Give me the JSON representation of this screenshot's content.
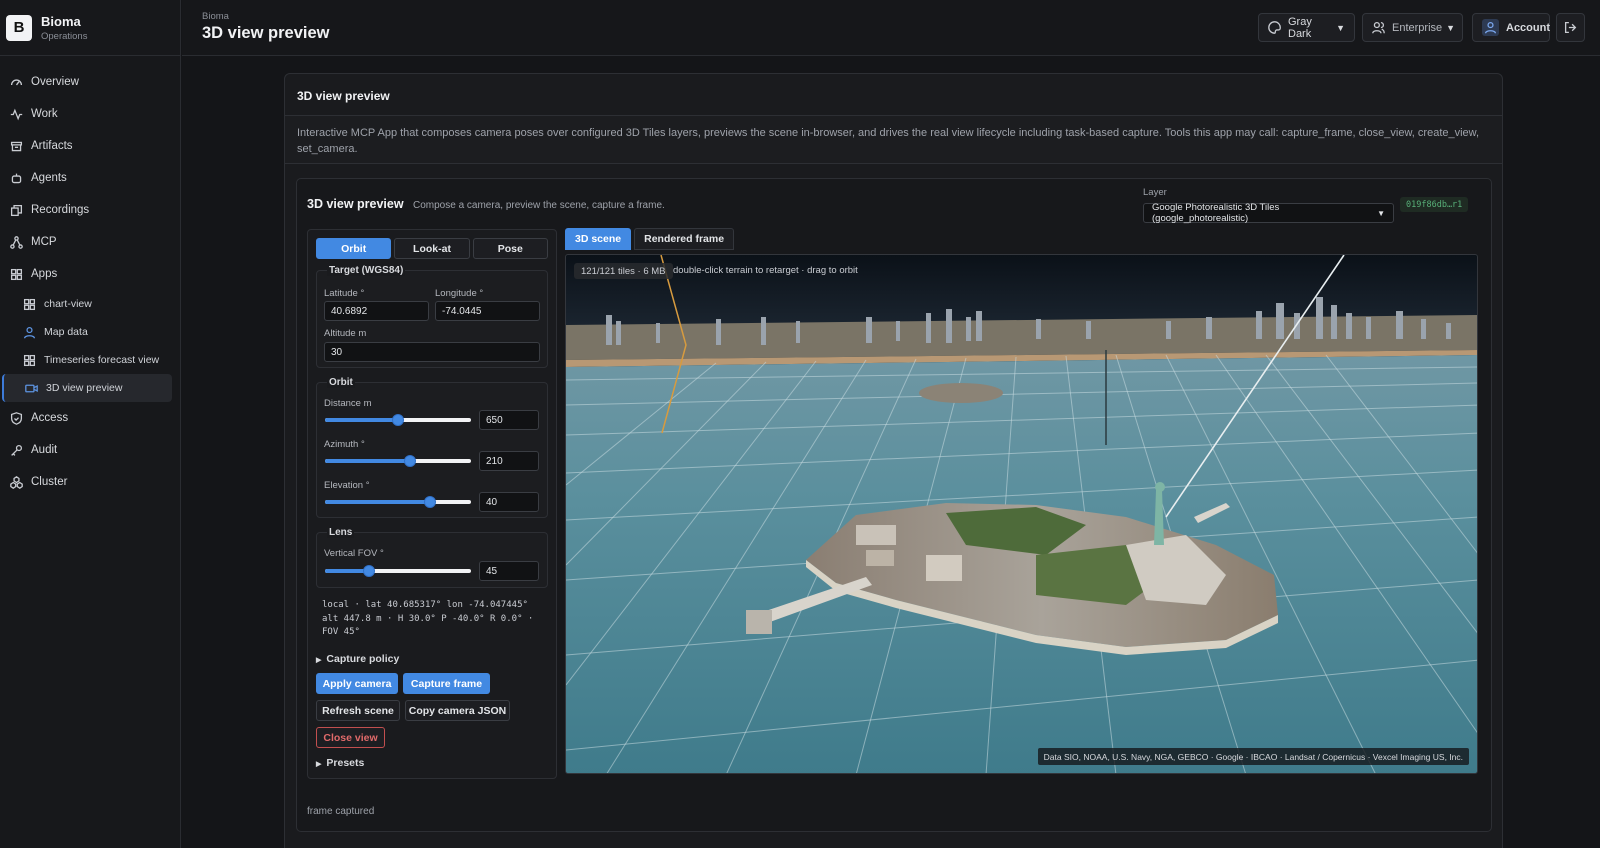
{
  "brand": {
    "letter": "B",
    "name": "Bioma",
    "subtitle": "Operations"
  },
  "nav": {
    "items": [
      {
        "label": "Overview",
        "icon": "gauge-icon"
      },
      {
        "label": "Work",
        "icon": "activity-icon"
      },
      {
        "label": "Artifacts",
        "icon": "archive-icon"
      },
      {
        "label": "Agents",
        "icon": "bot-icon"
      },
      {
        "label": "Recordings",
        "icon": "recordings-icon"
      },
      {
        "label": "MCP",
        "icon": "network-icon"
      },
      {
        "label": "Apps",
        "icon": "grid-icon"
      }
    ],
    "apps": [
      {
        "label": "chart-view",
        "icon": "grid-icon"
      },
      {
        "label": "Map data",
        "icon": "person-icon"
      },
      {
        "label": "Timeseries forecast view",
        "icon": "grid-icon"
      },
      {
        "label": "3D view preview",
        "icon": "camera-icon"
      }
    ],
    "bottom": [
      {
        "label": "Access",
        "icon": "shield-icon"
      },
      {
        "label": "Audit",
        "icon": "key-icon"
      },
      {
        "label": "Cluster",
        "icon": "cluster-icon"
      }
    ]
  },
  "header": {
    "breadcrumb": "Bioma",
    "title": "3D view preview",
    "theme": "Gray Dark",
    "tenant": "Enterprise",
    "account": "Account"
  },
  "card": {
    "title": "3D view preview",
    "description": "Interactive MCP App that composes camera poses over configured 3D Tiles layers, previews the scene in-browser, and drives the real view lifecycle including task-based capture. Tools this app may call: capture_frame, close_view, create_view, set_camera."
  },
  "app": {
    "title": "3D view preview",
    "subtitle": "Compose a camera, preview the scene, capture a frame.",
    "layer_label": "Layer",
    "layer_value": "Google Photorealistic 3D Tiles (google_photorealistic)",
    "view_id": "019f86db…r1",
    "modes": [
      "Orbit",
      "Look-at",
      "Pose"
    ],
    "active_mode": "Orbit",
    "target": {
      "legend": "Target (WGS84)",
      "latitude_label": "Latitude °",
      "latitude": "40.6892",
      "longitude_label": "Longitude °",
      "longitude": "-74.0445",
      "altitude_label": "Altitude m",
      "altitude": "30"
    },
    "orbit": {
      "legend": "Orbit",
      "distance_label": "Distance m",
      "distance": "650",
      "distance_fraction": 0.5,
      "azimuth_label": "Azimuth °",
      "azimuth": "210",
      "azimuth_fraction": 0.58,
      "elevation_label": "Elevation °",
      "elevation": "40",
      "elevation_fraction": 0.72
    },
    "lens": {
      "legend": "Lens",
      "fov_label": "Vertical FOV °",
      "fov": "45",
      "fov_fraction": 0.3
    },
    "pose_summary": "local · lat 40.685317° lon -74.047445° alt 447.8 m · H 30.0° P -40.0° R 0.0° · FOV 45°",
    "capture_policy": "Capture policy",
    "buttons": {
      "apply": "Apply camera",
      "capture": "Capture frame",
      "refresh": "Refresh scene",
      "copy": "Copy camera JSON",
      "close": "Close view"
    },
    "presets": "Presets",
    "tabs": [
      "3D scene",
      "Rendered frame"
    ],
    "tile_status": "121/121 tiles · 6 MB",
    "hint": "double-click terrain to retarget · drag to orbit",
    "attribution": "Data SIO, NOAA, U.S. Navy, NGA, GEBCO · Google · IBCAO · Landsat / Copernicus · Vexcel Imaging US, Inc.",
    "status": "frame captured"
  },
  "colors": {
    "accent": "#4289e2",
    "danger": "#c24f4f",
    "badge_green": "#58b079"
  }
}
